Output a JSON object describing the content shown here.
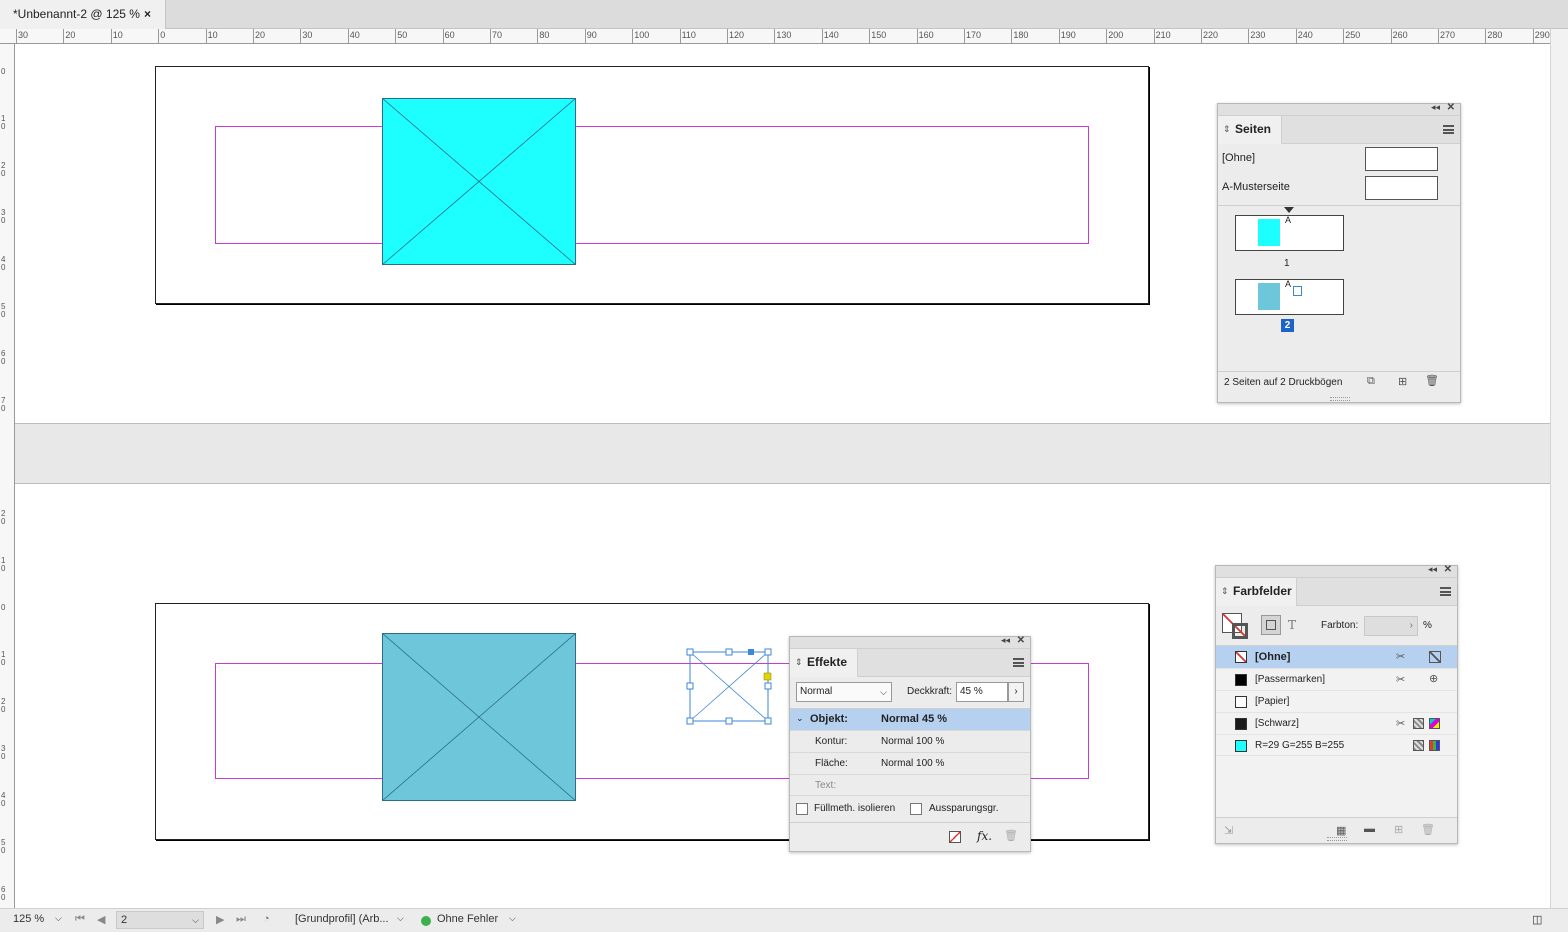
{
  "document": {
    "tab_title": "*Unbenannt-2 @ 125 %",
    "close_glyph": "×"
  },
  "ruler": {
    "h_labels": [
      "30",
      "20",
      "10",
      "0",
      "10",
      "20",
      "30",
      "40",
      "50",
      "60",
      "70",
      "80",
      "90",
      "100",
      "110",
      "120",
      "130",
      "140",
      "150",
      "160",
      "170",
      "180",
      "190",
      "200",
      "210",
      "220",
      "230",
      "240",
      "250",
      "260",
      "270",
      "280",
      "290"
    ],
    "v_labels_top": [
      "0",
      "1 0",
      "2 0",
      "3 0",
      "4 0",
      "5 0",
      "6 0",
      "7 0"
    ],
    "v_labels_bottom": [
      "2 0",
      "1 0",
      "0",
      "1 0",
      "2 0",
      "3 0",
      "4 0",
      "5 0",
      "6 0"
    ]
  },
  "pages_panel": {
    "title": "Seiten",
    "master_none": "[Ohne]",
    "master_a": "A-Musterseite",
    "page1_prefix": "A",
    "page1_number": "1",
    "page2_prefix": "A",
    "page2_number": "2",
    "footer_text": "2 Seiten auf 2 Druckbögen"
  },
  "effects_panel": {
    "title": "Effekte",
    "blend_mode": "Normal",
    "opacity_label": "Deckkraft:",
    "opacity_value": "45 %",
    "rows": [
      {
        "label": "Objekt:",
        "value": "Normal 45 %"
      },
      {
        "label": "Kontur:",
        "value": "Normal 100 %"
      },
      {
        "label": "Fläche:",
        "value": "Normal 100 %"
      },
      {
        "label": "Text:",
        "value": ""
      }
    ],
    "isolate_label": "Füllmeth. isolieren",
    "knockout_label": "Aussparungsgr.",
    "fx_label": "fx."
  },
  "swatches_panel": {
    "title": "Farbfelder",
    "tint_label": "Farbton:",
    "tint_unit": "%",
    "text_icon": "T",
    "items": [
      {
        "name": "[Ohne]",
        "color": "none"
      },
      {
        "name": "[Passermarken]",
        "color": "#000000"
      },
      {
        "name": "[Papier]",
        "color": "#ffffff"
      },
      {
        "name": "[Schwarz]",
        "color": "#1a1a1a"
      },
      {
        "name": "R=29 G=255 B=255",
        "color": "#1dffff"
      }
    ]
  },
  "statusbar": {
    "zoom": "125 %",
    "page": "2",
    "profile": "[Grundprofil] (Arb...",
    "preflight": "Ohne Fehler"
  },
  "colors": {
    "cyan_fill": "#1dffff",
    "cyan_transparent": "#6ec6da",
    "margin_magenta": "#c63bd1",
    "selection_blue": "#3e86d8",
    "selected_row": "#b6d1f0"
  }
}
